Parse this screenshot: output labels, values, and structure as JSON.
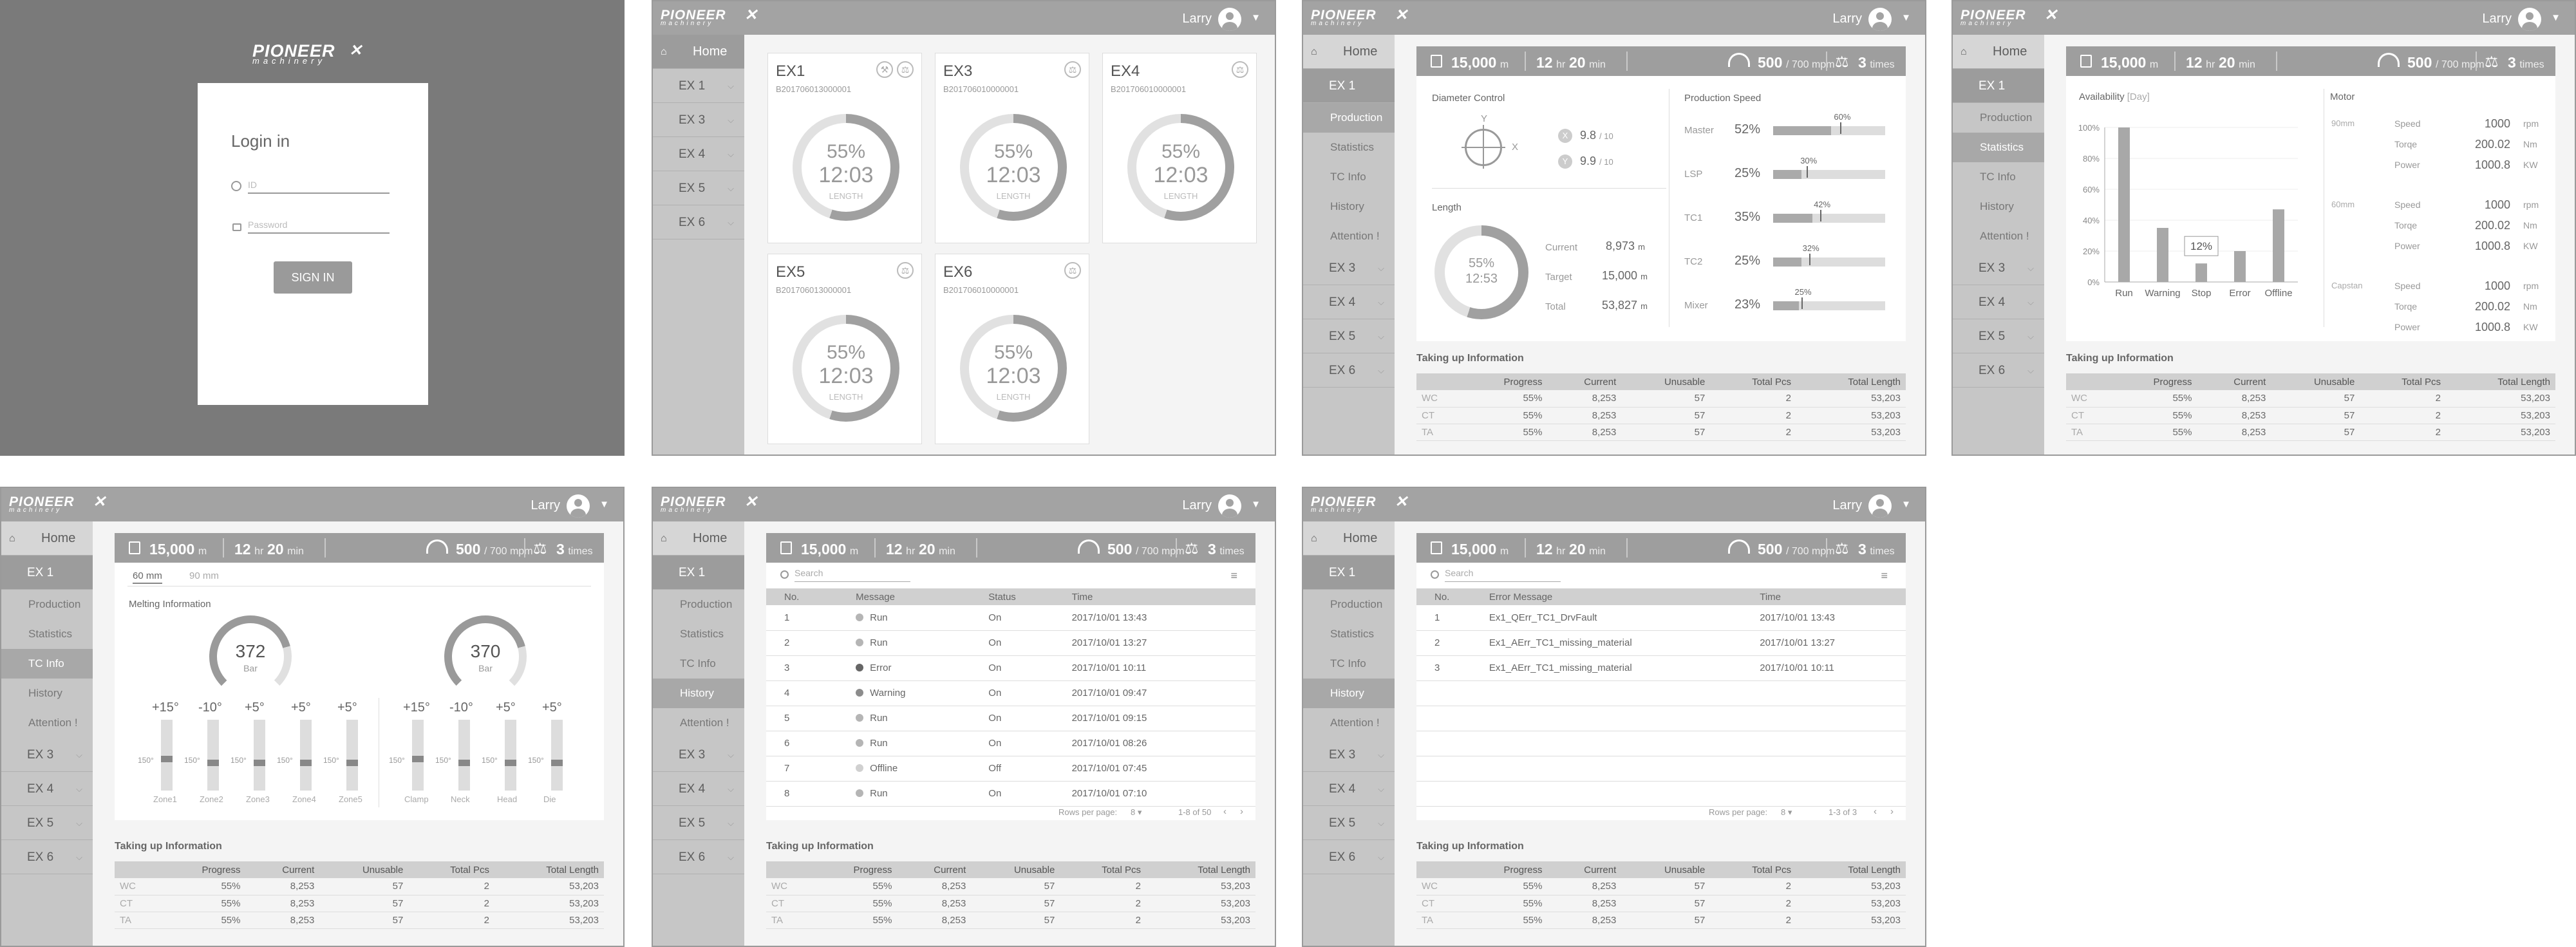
{
  "brand": {
    "name": "PIONEER",
    "tag": "machinery"
  },
  "user": {
    "name": "Larry"
  },
  "login": {
    "title": "Login in",
    "id_placeholder": "ID",
    "password_placeholder": "Password",
    "button": "SIGN IN"
  },
  "nav": {
    "home": "Home",
    "machines": [
      "EX 1",
      "EX 3",
      "EX 4",
      "EX 5",
      "EX 6"
    ],
    "sub": [
      "Production",
      "Statistics",
      "TC Info",
      "History",
      "Attention !"
    ]
  },
  "header": {
    "length_value": "15,000",
    "length_unit": "m",
    "time_hr": "12",
    "hr_unit": "hr",
    "time_min": "20",
    "min_unit": "min",
    "speed": "500",
    "speed_unit": "/ 700 mpm",
    "times": "3",
    "times_unit": "times"
  },
  "dashboard": {
    "cards": [
      {
        "name": "EX1",
        "serial": "B201706013000001",
        "percent": "55%",
        "time": "12:03",
        "label": "LENGTH"
      },
      {
        "name": "EX3",
        "serial": "B201706010000001",
        "percent": "55%",
        "time": "12:03",
        "label": "LENGTH"
      },
      {
        "name": "EX4",
        "serial": "B201706010000001",
        "percent": "55%",
        "time": "12:03",
        "label": "LENGTH"
      },
      {
        "name": "EX5",
        "serial": "B201706013000001",
        "percent": "55%",
        "time": "12:03",
        "label": "LENGTH"
      },
      {
        "name": "EX6",
        "serial": "B201706010000001",
        "percent": "55%",
        "time": "12:03",
        "label": "LENGTH"
      }
    ]
  },
  "production": {
    "diameter_title": "Diameter Control",
    "axis_y": "Y",
    "axis_x": "X",
    "x_val": "9.8",
    "y_val": "9.9",
    "dia_unit": "/ 10",
    "length_title": "Length",
    "ring_percent": "55%",
    "ring_time": "12:53",
    "current_label": "Current",
    "current": "8,973",
    "target_label": "Target",
    "target": "15,000",
    "total_label": "Total",
    "total": "53,827",
    "len_unit": "m",
    "speed_title": "Production Speed",
    "speeds": [
      {
        "name": "Master",
        "pct": "52%",
        "mark": "60%",
        "value": 52,
        "target": 60
      },
      {
        "name": "LSP",
        "pct": "25%",
        "mark": "30%",
        "value": 25,
        "target": 30
      },
      {
        "name": "TC1",
        "pct": "35%",
        "mark": "42%",
        "value": 35,
        "target": 42
      },
      {
        "name": "TC2",
        "pct": "25%",
        "mark": "32%",
        "value": 25,
        "target": 32
      },
      {
        "name": "Mixer",
        "pct": "23%",
        "mark": "25%",
        "value": 23,
        "target": 25
      }
    ]
  },
  "statistics": {
    "availability_title": "Availability",
    "period": "[Day]",
    "chart_data": {
      "type": "bar",
      "categories": [
        "Run",
        "Warning",
        "Stop",
        "Error",
        "Offline"
      ],
      "values": [
        100,
        35,
        12,
        20,
        47
      ],
      "ylim": [
        0,
        100
      ],
      "yticks": [
        "100%",
        "80%",
        "60%",
        "40%",
        "20%",
        "0%"
      ],
      "callout": "12%"
    },
    "motor_title": "Motor",
    "motors": [
      {
        "name": "90mm",
        "rows": [
          [
            "Speed",
            "1000",
            "rpm"
          ],
          [
            "Torqe",
            "200.02",
            "Nm"
          ],
          [
            "Power",
            "1000.8",
            "KW"
          ]
        ]
      },
      {
        "name": "60mm",
        "rows": [
          [
            "Speed",
            "1000",
            "rpm"
          ],
          [
            "Torqe",
            "200.02",
            "Nm"
          ],
          [
            "Power",
            "1000.8",
            "KW"
          ]
        ]
      },
      {
        "name": "Capstan",
        "rows": [
          [
            "Speed",
            "1000",
            "rpm"
          ],
          [
            "Torqe",
            "200.02",
            "Nm"
          ],
          [
            "Power",
            "1000.8",
            "KW"
          ]
        ]
      }
    ]
  },
  "tcinfo": {
    "tabs": [
      "60 mm",
      "90 mm"
    ],
    "title": "Melting Information",
    "left": {
      "pressure": "372",
      "unit": "Bar",
      "zones": [
        {
          "d": "+15°",
          "n": "Zone1"
        },
        {
          "d": "-10°",
          "n": "Zone2"
        },
        {
          "d": "+5°",
          "n": "Zone3"
        },
        {
          "d": "+5°",
          "n": "Zone4"
        },
        {
          "d": "+5°",
          "n": "Zone5"
        }
      ]
    },
    "right": {
      "pressure": "370",
      "unit": "Bar",
      "zones": [
        {
          "d": "+15°",
          "n": "Clamp"
        },
        {
          "d": "-10°",
          "n": "Neck"
        },
        {
          "d": "+5°",
          "n": "Head"
        },
        {
          "d": "+5°",
          "n": "Die"
        }
      ]
    },
    "base": "150°"
  },
  "history": {
    "search": "Search",
    "cols": [
      "No.",
      "Message",
      "Status",
      "Time"
    ],
    "rows": [
      [
        "1",
        "Run",
        "On",
        "2017/10/01 13:43"
      ],
      [
        "2",
        "Run",
        "On",
        "2017/10/01 13:27"
      ],
      [
        "3",
        "Error",
        "On",
        "2017/10/01 10:11"
      ],
      [
        "4",
        "Warning",
        "On",
        "2017/10/01 09:47"
      ],
      [
        "5",
        "Run",
        "On",
        "2017/10/01 09:15"
      ],
      [
        "6",
        "Run",
        "On",
        "2017/10/01 08:26"
      ],
      [
        "7",
        "Offline",
        "Off",
        "2017/10/01 07:45"
      ],
      [
        "8",
        "Run",
        "On",
        "2017/10/01 07:10"
      ]
    ],
    "rpp_label": "Rows per page:",
    "rpp": "8",
    "range": "1-8 of 50"
  },
  "attention": {
    "search": "Search",
    "cols": [
      "No.",
      "Error Message",
      "Time"
    ],
    "rows": [
      [
        "1",
        "Ex1_QErr_TC1_DrvFault",
        "2017/10/01 13:43"
      ],
      [
        "2",
        "Ex1_AErr_TC1_missing_material",
        "2017/10/01 13:27"
      ],
      [
        "3",
        "Ex1_AErr_TC1_missing_material",
        "2017/10/01 10:11"
      ]
    ],
    "rpp_label": "Rows per page:",
    "rpp": "8",
    "range": "1-3 of 3"
  },
  "takeup": {
    "title": "Taking up Information",
    "cols": [
      "",
      "Progress",
      "Current",
      "Unusable",
      "Total Pcs",
      "Total Length"
    ],
    "rows": [
      [
        "WC",
        "55%",
        "8,253",
        "57",
        "2",
        "53,203"
      ],
      [
        "CT",
        "55%",
        "8,253",
        "57",
        "2",
        "53,203"
      ],
      [
        "TA",
        "55%",
        "8,253",
        "57",
        "2",
        "53,203"
      ]
    ]
  }
}
